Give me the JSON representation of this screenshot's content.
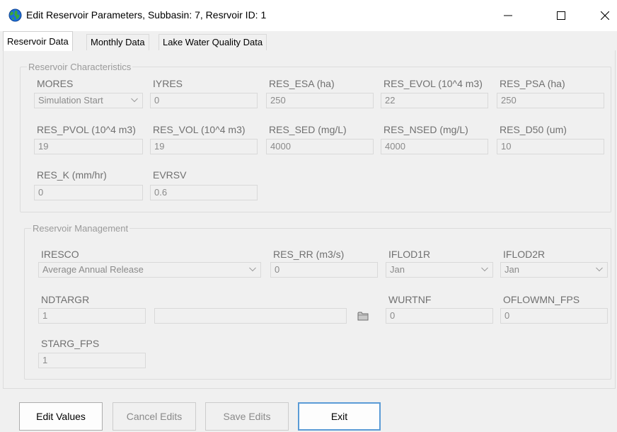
{
  "window": {
    "title": "Edit Reservoir Parameters, Subbasin: 7, Resrvoir ID:  1",
    "minimize_icon": "minimize-icon",
    "maximize_icon": "maximize-icon",
    "close_icon": "close-icon",
    "app_icon": "globe-icon"
  },
  "tabs": [
    {
      "label": "Reservoir Data",
      "active": true
    },
    {
      "label": "Monthly Data",
      "active": false
    },
    {
      "label": "Lake Water Quality Data",
      "active": false
    }
  ],
  "characteristics": {
    "legend": "Reservoir Characteristics",
    "mores": {
      "label": "MORES",
      "value": "Simulation Start"
    },
    "iyres": {
      "label": "IYRES",
      "value": "0"
    },
    "res_esa": {
      "label": "RES_ESA (ha)",
      "value": "250"
    },
    "res_evol": {
      "label": "RES_EVOL (10^4 m3)",
      "value": "22"
    },
    "res_psa": {
      "label": "RES_PSA (ha)",
      "value": "250"
    },
    "res_pvol": {
      "label": "RES_PVOL (10^4 m3)",
      "value": "19"
    },
    "res_vol": {
      "label": "RES_VOL (10^4 m3)",
      "value": "19"
    },
    "res_sed": {
      "label": "RES_SED (mg/L)",
      "value": "4000"
    },
    "res_nsed": {
      "label": "RES_NSED (mg/L)",
      "value": "4000"
    },
    "res_d50": {
      "label": "RES_D50 (um)",
      "value": "10"
    },
    "res_k": {
      "label": "RES_K (mm/hr)",
      "value": "0"
    },
    "evrsv": {
      "label": "EVRSV",
      "value": "0.6"
    }
  },
  "management": {
    "legend": "Reservoir Management",
    "iresco": {
      "label": "IRESCO",
      "value": "Average Annual Release"
    },
    "res_rr": {
      "label": "RES_RR (m3/s)",
      "value": "0"
    },
    "iflod1r": {
      "label": "IFLOD1R",
      "value": "Jan"
    },
    "iflod2r": {
      "label": "IFLOD2R",
      "value": "Jan"
    },
    "ndtargr": {
      "label": "NDTARGR",
      "value": "1",
      "file_value": ""
    },
    "wurtnf": {
      "label": "WURTNF",
      "value": "0"
    },
    "oflowmn_fps": {
      "label": "OFLOWMN_FPS",
      "value": "0"
    },
    "starg_fps": {
      "label": "STARG_FPS",
      "value": "1"
    },
    "browse_icon": "folder-icon"
  },
  "buttons": {
    "edit": "Edit Values",
    "cancel": "Cancel Edits",
    "save": "Save Edits",
    "exit": "Exit"
  },
  "colors": {
    "background": "#f0f0f0",
    "disabled_text": "#8a8a8a",
    "focus_border": "#5a9bd6"
  }
}
